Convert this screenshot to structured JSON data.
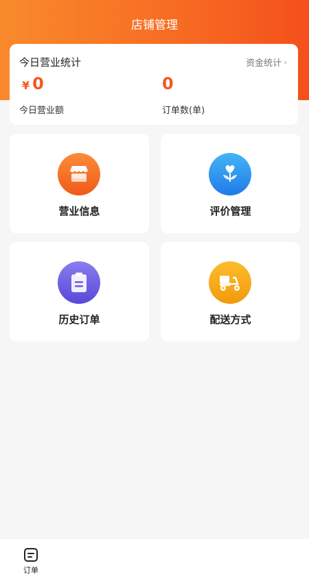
{
  "header": {
    "title": "店铺管理"
  },
  "stats": {
    "title": "今日营业统计",
    "fund_link": "资金统计",
    "currency": "¥",
    "revenue_value": "0",
    "revenue_label": "今日营业额",
    "orders_value": "0",
    "orders_label": "订单数(单)"
  },
  "tiles": [
    {
      "label": "营业信息",
      "icon": "store-icon",
      "color": "#f56a20"
    },
    {
      "label": "评价管理",
      "icon": "heart-plant-icon",
      "color": "#2a8ff0"
    },
    {
      "label": "历史订单",
      "icon": "clipboard-icon",
      "color": "#6a5ae0"
    },
    {
      "label": "配送方式",
      "icon": "scooter-icon",
      "color": "#f6a81a"
    }
  ],
  "tabbar": {
    "orders_label": "订单"
  },
  "colors": {
    "accent": "#f4581e",
    "header_start": "#f98a2c",
    "header_end": "#f4501b"
  }
}
